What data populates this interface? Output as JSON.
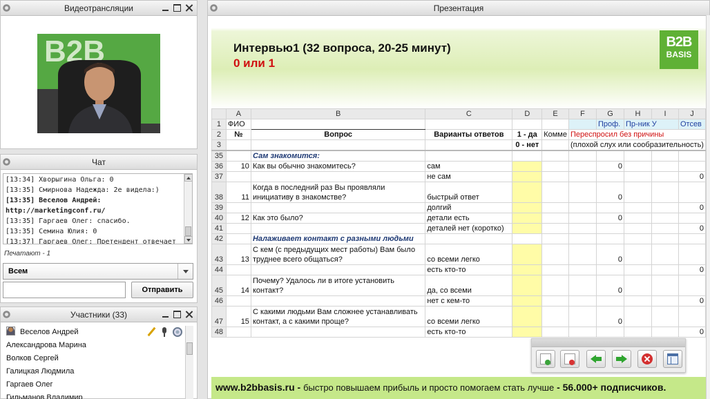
{
  "video_panel": {
    "title": "Видеотрансляции"
  },
  "chat_panel": {
    "title": "Чат",
    "messages": [
      "[13:34] Хворыгина Ольга: 0",
      "[13:35] Смирнова Надежда: 2е видела:)",
      "[13:35] Веселов Андрей:",
      "http://marketingconf.ru/",
      "[13:35] Гаргаев Олег: спасибо.",
      "[13:35] Семина Юлия: 0",
      "[13:37] Гаргаев Олег: Претендент отвечает"
    ],
    "typing": "Печатают - 1",
    "recipient": "Всем",
    "input_placeholder": "",
    "send_label": "Отправить"
  },
  "participants_panel": {
    "title": "Участники (33)",
    "people": [
      "Веселов Андрей",
      "Александрова Марина",
      "Волков Сергей",
      "Галицкая Людмила",
      "Гаргаев Олег",
      "Гильманов Владимир"
    ]
  },
  "presentation_panel": {
    "title": "Презентация",
    "slide": {
      "title": "Интервью1 (32 вопроса, 20-25 минут)",
      "subtitle": "0 или 1",
      "logo_line1": "B2B",
      "logo_line2": "BASIS",
      "col_letters": [
        "A",
        "B",
        "C",
        "D",
        "E",
        "F",
        "G",
        "H",
        "I",
        "J"
      ],
      "row1": {
        "rn": "1",
        "a": "ФИО",
        "g": "Проф.",
        "h": "Пр-ник У",
        "j": "Отсев"
      },
      "row2": {
        "rn": "2",
        "a": "№",
        "b": "Вопрос",
        "c": "Варианты ответов",
        "d": "1 - да",
        "e": "Комме",
        "f": "Переспросил без причины"
      },
      "row3": {
        "rn": "3",
        "d": "0 - нет",
        "f": "(плохой слух или сообразительность)"
      },
      "rows": [
        {
          "rn": "35",
          "a": "",
          "b": "Сам знакомится:",
          "c": "",
          "g": "",
          "j": "",
          "section": true
        },
        {
          "rn": "36",
          "a": "10",
          "b": "Как вы обычно знакомитесь?",
          "c": "сам",
          "g": "0",
          "j": ""
        },
        {
          "rn": "37",
          "a": "",
          "b": "",
          "c": "не сам",
          "g": "",
          "j": "0"
        },
        {
          "rn": "38",
          "a": "11",
          "b": "Когда в последний раз Вы проявляли инициативу в знакомстве?",
          "c": "быстрый ответ",
          "g": "0",
          "j": "",
          "tall": true
        },
        {
          "rn": "39",
          "a": "",
          "b": "",
          "c": "долгий",
          "g": "",
          "j": "0"
        },
        {
          "rn": "40",
          "a": "12",
          "b": "Как это было?",
          "c": "детали есть",
          "g": "0",
          "j": ""
        },
        {
          "rn": "41",
          "a": "",
          "b": "",
          "c": "деталей нет (коротко)",
          "g": "",
          "j": "0"
        },
        {
          "rn": "42",
          "a": "",
          "b": "Налаживает контакт с разными людьми",
          "c": "",
          "g": "",
          "j": "",
          "section": true
        },
        {
          "rn": "43",
          "a": "13",
          "b": "С кем (с предыдущих мест работы) Вам было труднее всего общаться?",
          "c": "со всеми легко",
          "g": "0",
          "j": "",
          "tall": true
        },
        {
          "rn": "44",
          "a": "",
          "b": "",
          "c": "есть кто-то",
          "g": "",
          "j": "0"
        },
        {
          "rn": "45",
          "a": "14",
          "b": "Почему? Удалось ли в итоге установить контакт?",
          "c": "да, со всеми",
          "g": "0",
          "j": "",
          "tall": true
        },
        {
          "rn": "46",
          "a": "",
          "b": "",
          "c": "нет с кем-то",
          "g": "",
          "j": "0"
        },
        {
          "rn": "47",
          "a": "15",
          "b": "С какими людьми Вам сложнее устанавливать контакт, а с какими проще?",
          "c": "со всеми легко",
          "g": "0",
          "j": "",
          "tall": true
        },
        {
          "rn": "48",
          "a": "",
          "b": "",
          "c": "есть кто-то",
          "g": "",
          "j": "0"
        }
      ],
      "footer_site": "www.b2bbasis.ru",
      "footer_dash1": " - ",
      "footer_text": "быстро повышаем прибыль и просто помогаем стать лучше",
      "footer_dash2": " - ",
      "footer_subs": "56.000+ подписчиков."
    }
  },
  "colors": {
    "accent_green": "#5fb135",
    "footer_green": "#c5e889",
    "highlight_yellow": "#fffca7",
    "red_text": "#d01010"
  },
  "icons": [
    "gear-icon",
    "minimize-icon",
    "maximize-icon",
    "close-icon",
    "pen-icon",
    "microphone-icon",
    "webcam-icon",
    "user-icon",
    "add-page-icon",
    "delete-page-icon",
    "arrow-left-icon",
    "arrow-right-icon",
    "close-circle-icon",
    "layout-icon"
  ]
}
